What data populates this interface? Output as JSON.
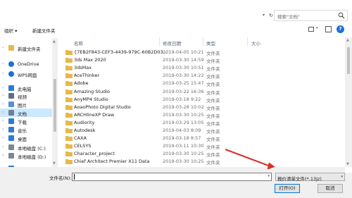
{
  "search": {
    "placeholder": "搜索\"文档\""
  },
  "toolbar": {
    "organize": "组织 ▾",
    "new_folder": "新建文件夹"
  },
  "nav": {
    "items": [
      {
        "label": "新建文件夹",
        "icon": "folder-icon",
        "color": "#e8b84a"
      },
      {
        "label": "OneDrive",
        "icon": "cloud-icon",
        "color": "#1e6fd9"
      },
      {
        "label": "WPS网盘",
        "icon": "cloud-icon",
        "color": "#1e6fd9"
      },
      {
        "label": "此电脑",
        "icon": "computer-icon",
        "color": "#2f7bd1"
      },
      {
        "label": "视频",
        "icon": "video-icon",
        "color": "#5a6e8c"
      },
      {
        "label": "图片",
        "icon": "picture-icon",
        "color": "#5a8fd0"
      },
      {
        "label": "文档",
        "icon": "document-icon",
        "color": "#6d7f99"
      },
      {
        "label": "下载",
        "icon": "download-icon",
        "color": "#2f7bd1"
      },
      {
        "label": "音乐",
        "icon": "music-icon",
        "color": "#2f7bd1"
      },
      {
        "label": "桌面",
        "icon": "desktop-icon",
        "color": "#2f7bd1"
      },
      {
        "label": "本地磁盘 (C:)",
        "icon": "drive-icon",
        "color": "#7a8896"
      },
      {
        "label": "本地磁盘 (D:)",
        "icon": "drive-icon",
        "color": "#7a8896"
      },
      {
        "label": "网络",
        "icon": "network-icon",
        "color": "#2f7bd1"
      }
    ]
  },
  "columns": {
    "name": "名称",
    "date": "修改日期",
    "type": "类型",
    "size": "大小"
  },
  "files": [
    {
      "name": "{7EB2F843-CEF3-4439-979C-60B2D03...",
      "date": "2019-04-05 10:21",
      "type": "文件夹"
    },
    {
      "name": "3ds Max 2020",
      "date": "2019-03-30 14:59",
      "type": "文件夹"
    },
    {
      "name": "3dsMax",
      "date": "2019-03-30 10:51",
      "type": "文件夹"
    },
    {
      "name": "AceThinker",
      "date": "2019-03-30 14:22",
      "type": "文件夹"
    },
    {
      "name": "Adobe",
      "date": "2019-03-25 15:47",
      "type": "文件夹"
    },
    {
      "name": "Amazing Studio",
      "date": "2019-03-22 16:36",
      "type": "文件夹"
    },
    {
      "name": "AnyMP4 Studio",
      "date": "2019-03-18 9:22",
      "type": "文件夹"
    },
    {
      "name": "AoaoPhoto Digital Studio",
      "date": "2019-03-28 10:02",
      "type": "文件夹"
    },
    {
      "name": "ARCHlineXP Draw",
      "date": "2019-03-30 10:25",
      "type": "文件夹"
    },
    {
      "name": "Audiority",
      "date": "2019-03-29 13:05",
      "type": "文件夹"
    },
    {
      "name": "Autodesk",
      "date": "2019-04-03 8:09",
      "type": "文件夹"
    },
    {
      "name": "CAXA",
      "date": "2019-03-18 8:57",
      "type": "文件夹"
    },
    {
      "name": "CELSYS",
      "date": "2019-03-11 10:30",
      "type": "文件夹"
    },
    {
      "name": "Character_project",
      "date": "2019-03-30 10:25",
      "type": "文件夹"
    },
    {
      "name": "Chief Architect Premier X11 Data",
      "date": "2019-03-30 10:25",
      "type": "文件夹"
    }
  ],
  "footer": {
    "filename_label": "文件名(N):",
    "filename_value": "",
    "filter": "报价清单文件(*.13jz)",
    "open": "打开(O)",
    "cancel": "取消"
  },
  "colors": {
    "selected": "#cce8ff",
    "folder": "#e8b84a",
    "accent": "#0078d7",
    "annotation_arrow": "#d9302c"
  }
}
